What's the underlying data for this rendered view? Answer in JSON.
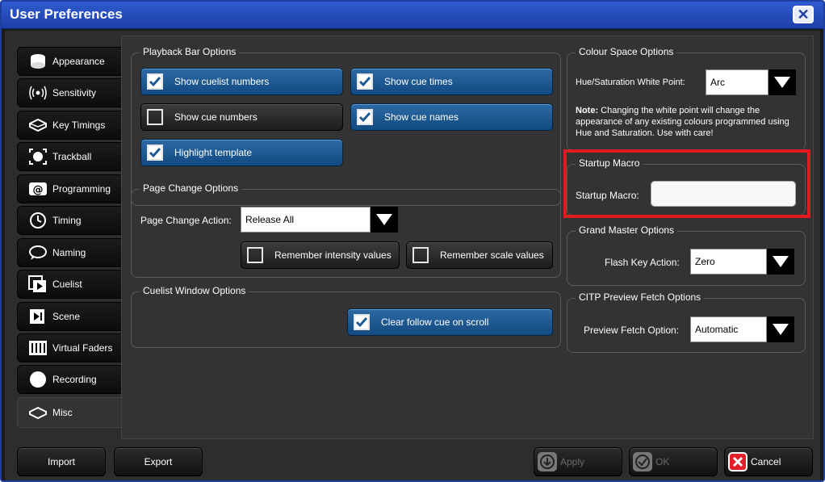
{
  "window": {
    "title": "User Preferences"
  },
  "sidebar": {
    "items": [
      {
        "label": "Appearance",
        "icon": "appearance-icon"
      },
      {
        "label": "Sensitivity",
        "icon": "sensitivity-icon"
      },
      {
        "label": "Key Timings",
        "icon": "key-timings-icon"
      },
      {
        "label": "Trackball",
        "icon": "trackball-icon"
      },
      {
        "label": "Programming",
        "icon": "programming-icon"
      },
      {
        "label": "Timing",
        "icon": "timing-icon"
      },
      {
        "label": "Naming",
        "icon": "naming-icon"
      },
      {
        "label": "Cuelist",
        "icon": "cuelist-icon"
      },
      {
        "label": "Scene",
        "icon": "scene-icon"
      },
      {
        "label": "Virtual Faders",
        "icon": "virtual-faders-icon"
      },
      {
        "label": "Recording",
        "icon": "recording-icon"
      },
      {
        "label": "Misc",
        "icon": "misc-icon",
        "active": true
      }
    ]
  },
  "playback": {
    "title": "Playback Bar Options",
    "show_cuelist_numbers": {
      "label": "Show cuelist numbers",
      "checked": true
    },
    "show_cue_times": {
      "label": "Show cue times",
      "checked": true
    },
    "show_cue_numbers": {
      "label": "Show cue numbers",
      "checked": false
    },
    "show_cue_names": {
      "label": "Show cue names",
      "checked": true
    },
    "highlight_template": {
      "label": "Highlight template",
      "checked": true
    }
  },
  "page_change": {
    "title": "Page Change Options",
    "action_label": "Page Change Action:",
    "action_value": "Release All",
    "remember_intensity": {
      "label": "Remember intensity values",
      "checked": false
    },
    "remember_scale": {
      "label": "Remember scale values",
      "checked": false
    }
  },
  "cuelist_window": {
    "title": "Cuelist Window Options",
    "clear_follow": {
      "label": "Clear follow cue on scroll",
      "checked": true
    }
  },
  "colour_space": {
    "title": "Colour Space Options",
    "white_point_label": "Hue/Saturation White Point:",
    "white_point_value": "Arc",
    "note_bold": "Note:",
    "note_text": " Changing the white point will change the appearance of any existing colours programmed using Hue and Saturation. Use with care!"
  },
  "startup_macro": {
    "title": "Startup Macro",
    "label": "Startup Macro:",
    "value": ""
  },
  "grand_master": {
    "title": "Grand Master Options",
    "label": "Flash Key Action:",
    "value": "Zero"
  },
  "citp": {
    "title": "CITP Preview Fetch Options",
    "label": "Preview Fetch Option:",
    "value": "Automatic"
  },
  "buttons": {
    "import": "Import",
    "export": "Export",
    "apply": "Apply",
    "ok": "OK",
    "cancel": "Cancel"
  },
  "colors": {
    "accent": "#1d3fa8",
    "button_blue": "#1f5a93",
    "highlight": "#e01b24"
  }
}
